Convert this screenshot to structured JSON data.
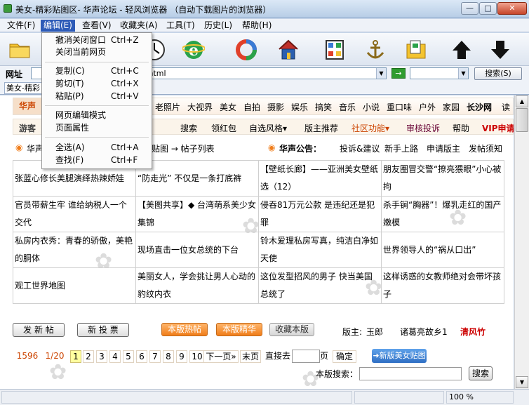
{
  "window": {
    "title": "美女-精彩贴图区- 华声论坛 - 轻风浏览器 （自动下载图片的浏览器）",
    "min_label": "—",
    "max_label": "□",
    "close_label": "✕"
  },
  "menubar": [
    "文件(F)",
    "编辑(E)",
    "查看(V)",
    "收藏夹(A)",
    "工具(T)",
    "历史(L)",
    "帮助(H)"
  ],
  "edit_menu": {
    "items": [
      {
        "label": "撤消关闭窗口",
        "shortcut": "Ctrl+Z"
      },
      {
        "label": "关闭当前网页",
        "shortcut": ""
      },
      {
        "label": "复制(C)",
        "shortcut": "Ctrl+C"
      },
      {
        "label": "剪切(T)",
        "shortcut": "Ctrl+X"
      },
      {
        "label": "粘贴(P)",
        "shortcut": "Ctrl+V"
      },
      {
        "label": "网页编辑模式",
        "shortcut": ""
      },
      {
        "label": "页面属性",
        "shortcut": ""
      },
      {
        "label": "全选(A)",
        "shortcut": "Ctrl+A"
      },
      {
        "label": "查找(F)",
        "shortcut": "Ctrl+F"
      }
    ]
  },
  "toolbar": {
    "icons": [
      "folder-icon",
      "clock-icon",
      "ie-icon",
      "refresh-ring-icon",
      "home-icon",
      "grid-icon",
      "anchor-icon",
      "folder-pages-icon",
      "up-arrow-icon",
      "down-arrow-icon"
    ]
  },
  "address": {
    "label": "网址",
    "value": "1.html",
    "go_label": "→",
    "search_button": "搜索(S)"
  },
  "tab": {
    "label": "美女-精彩"
  },
  "forum": {
    "nav1_tag": "华声",
    "nav1": [
      "老照片",
      "大视界",
      "美女",
      "自拍",
      "摄影",
      "娱乐",
      "搞笑",
      "音乐",
      "小说",
      "重口味",
      "户外",
      "家园",
      "长沙网",
      "读"
    ],
    "nav2_tag": "游客",
    "nav2": [
      "搜索",
      "领红包",
      "自选风格▾",
      "版主推荐",
      "社区功能▾",
      "审核投诉",
      "帮助",
      "VIP申请"
    ],
    "crumb_start": "华声",
    "crumb": "贴图 → 帖子列表",
    "announce_label": "华声公告：",
    "announce": [
      "投诉&建议",
      "新手上路",
      "申请版主",
      "发帖须知"
    ],
    "threads": [
      [
        "张蓝心修长美腿演绎热辣娇娃",
        "“防走光” 不仅是一条打底裤",
        "【壁纸长廊】——亚洲美女壁纸选（12）",
        "朋友圈冒交警“撩亮猥眼”小心被拘"
      ],
      [
        "官员带薪生牢 谁给纳税人一个交代",
        "【美图共享】◆ 台湾萌系美少女集锦",
        "侵吞81万元公款 是违纪还是犯罪",
        "杀手锏“胸器”！爆乳走红的国产嫩模"
      ],
      [
        "私房内衣秀：青春的骄傲，美艳的胴体",
        "现场直击一位女总统的下台",
        "铃木爱理私房写真，纯洁白净如天使",
        "世界领导人的“祸从口出”"
      ],
      [
        "观工世界地图",
        "美丽女人，学会挑让男人心动的豹纹内衣",
        "这位发型招风的男子 快当美国总统了",
        "这样诱惑的女教师绝对会带坏孩子"
      ]
    ],
    "post_button": "发 新 帖",
    "poll_button": "新 投 票",
    "hot_button": "本版热帖",
    "best_button": "本版精华",
    "fav_button": "收藏本版",
    "moderators_label": "版主:",
    "moderators": [
      "玉郎",
      "诸葛亮故乡1",
      "清风竹"
    ],
    "pager": {
      "total": "1596",
      "pages": "1/20",
      "numbers": [
        "1",
        "2",
        "3",
        "4",
        "5",
        "6",
        "7",
        "8",
        "9",
        "10"
      ],
      "next": "下一页»",
      "last": "末页",
      "goto_label": "直接去",
      "page_unit": "页",
      "confirm": "确定",
      "new_post": "➜新版美女贴图"
    },
    "board_search_label": "本版搜索：",
    "board_search_button": "搜索"
  },
  "status": {
    "zoom": "100 %"
  }
}
